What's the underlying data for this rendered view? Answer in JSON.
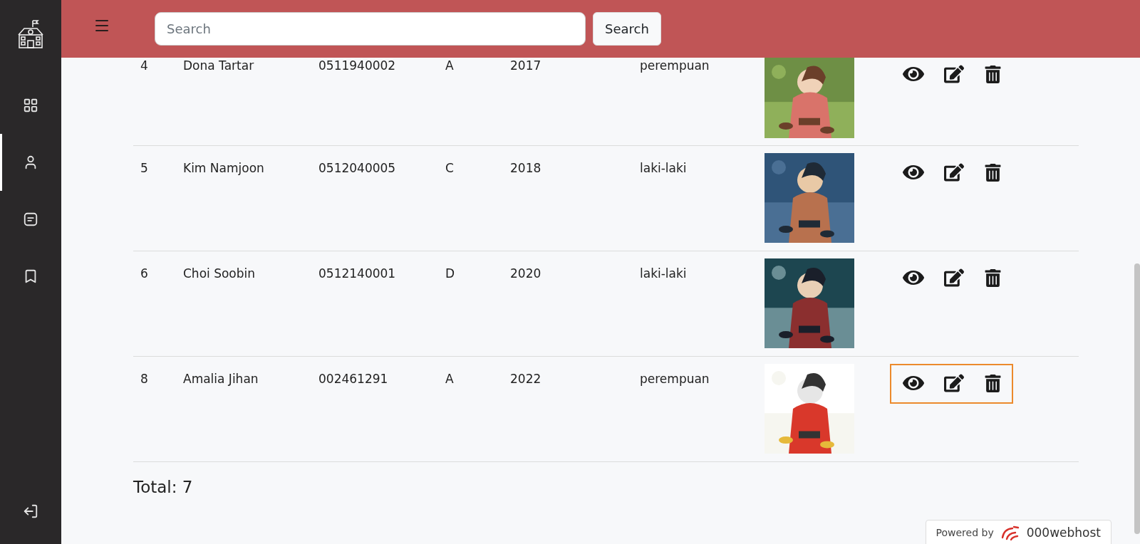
{
  "sidebar": {
    "items": [
      {
        "kind": "grid",
        "selected": false
      },
      {
        "kind": "user",
        "selected": true
      },
      {
        "kind": "note",
        "selected": false
      },
      {
        "kind": "bookmark",
        "selected": false
      }
    ],
    "footer": {
      "kind": "logout"
    }
  },
  "header": {
    "search": {
      "placeholder": "Search"
    },
    "button": "Search"
  },
  "table": {
    "rows": [
      {
        "no": "4",
        "name": "Dona Tartar",
        "nim": "0511940002",
        "class": "A",
        "year": "2017",
        "gender": "perempuan",
        "actions_highlighted": false
      },
      {
        "no": "5",
        "name": "Kim Namjoon",
        "nim": "0512040005",
        "class": "C",
        "year": "2018",
        "gender": "laki-laki",
        "actions_highlighted": false
      },
      {
        "no": "6",
        "name": "Choi Soobin",
        "nim": "0512140001",
        "class": "D",
        "year": "2020",
        "gender": "laki-laki",
        "actions_highlighted": false
      },
      {
        "no": "8",
        "name": "Amalia Jihan",
        "nim": "002461291",
        "class": "A",
        "year": "2022",
        "gender": "perempuan",
        "actions_highlighted": true
      }
    ]
  },
  "total": "Total: 7",
  "badge": {
    "prefix": "Powered by",
    "brand": "000webhost"
  }
}
